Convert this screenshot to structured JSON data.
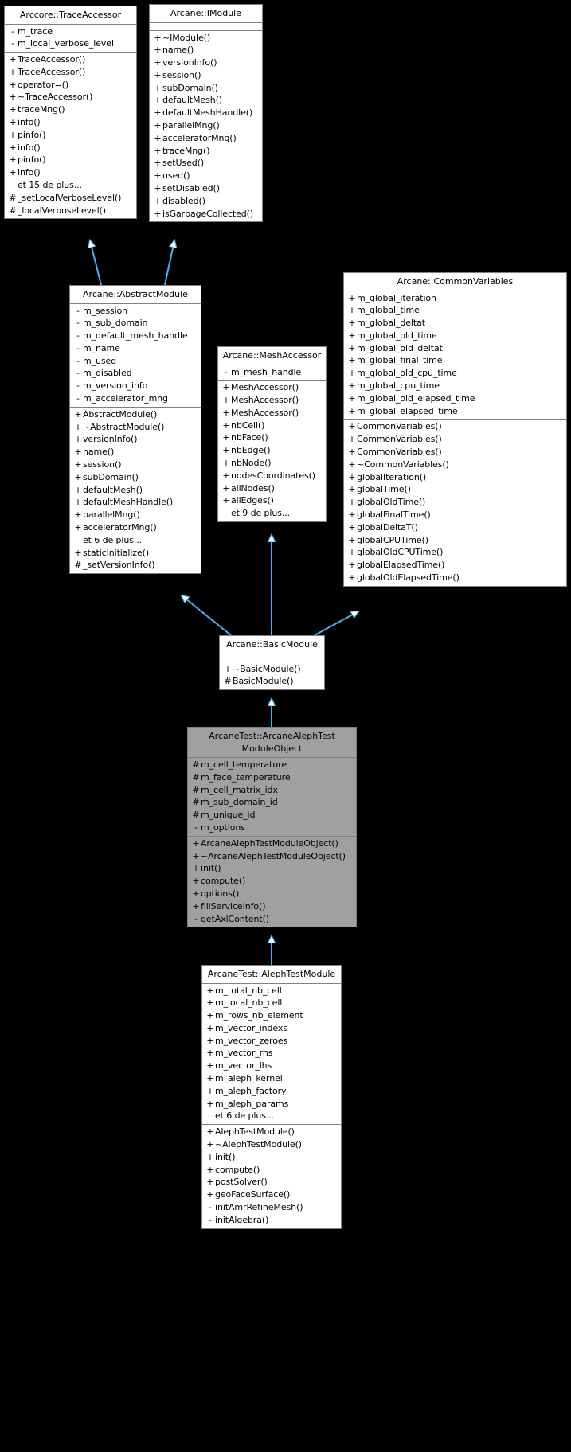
{
  "diagram": {
    "type": "uml-class-inheritance",
    "background_color": "#000000",
    "edge_color": "#4ab0f0",
    "box_fill": "#ffffff",
    "highlight_fill": "#a0a0a0",
    "border_color": "#808080"
  },
  "classes": {
    "trace_accessor": {
      "name": "Arccore::TraceAccessor",
      "attributes": [
        {
          "vis": "-",
          "label": "m_trace"
        },
        {
          "vis": "-",
          "label": "m_local_verbose_level"
        }
      ],
      "operations": [
        {
          "vis": "+",
          "label": "TraceAccessor()"
        },
        {
          "vis": "+",
          "label": "TraceAccessor()"
        },
        {
          "vis": "+",
          "label": "operator=()"
        },
        {
          "vis": "+",
          "label": "~TraceAccessor()"
        },
        {
          "vis": "+",
          "label": "traceMng()"
        },
        {
          "vis": "+",
          "label": "info()"
        },
        {
          "vis": "+",
          "label": "pinfo()"
        },
        {
          "vis": "+",
          "label": "info()"
        },
        {
          "vis": "+",
          "label": "pinfo()"
        },
        {
          "vis": "+",
          "label": "info()"
        },
        {
          "vis": "",
          "label": "et 15 de plus..."
        },
        {
          "vis": "#",
          "label": "_setLocalVerboseLevel()"
        },
        {
          "vis": "#",
          "label": "_localVerboseLevel()"
        }
      ]
    },
    "imodule": {
      "name": "Arcane::IModule",
      "attributes": [],
      "operations": [
        {
          "vis": "+",
          "label": "~IModule()"
        },
        {
          "vis": "+",
          "label": "name()"
        },
        {
          "vis": "+",
          "label": "versionInfo()"
        },
        {
          "vis": "+",
          "label": "session()"
        },
        {
          "vis": "+",
          "label": "subDomain()"
        },
        {
          "vis": "+",
          "label": "defaultMesh()"
        },
        {
          "vis": "+",
          "label": "defaultMeshHandle()"
        },
        {
          "vis": "+",
          "label": "parallelMng()"
        },
        {
          "vis": "+",
          "label": "acceleratorMng()"
        },
        {
          "vis": "+",
          "label": "traceMng()"
        },
        {
          "vis": "+",
          "label": "setUsed()"
        },
        {
          "vis": "+",
          "label": "used()"
        },
        {
          "vis": "+",
          "label": "setDisabled()"
        },
        {
          "vis": "+",
          "label": "disabled()"
        },
        {
          "vis": "+",
          "label": "isGarbageCollected()"
        }
      ]
    },
    "abstract_module": {
      "name": "Arcane::AbstractModule",
      "attributes": [
        {
          "vis": "-",
          "label": "m_session"
        },
        {
          "vis": "-",
          "label": "m_sub_domain"
        },
        {
          "vis": "-",
          "label": "m_default_mesh_handle"
        },
        {
          "vis": "-",
          "label": "m_name"
        },
        {
          "vis": "-",
          "label": "m_used"
        },
        {
          "vis": "-",
          "label": "m_disabled"
        },
        {
          "vis": "-",
          "label": "m_version_info"
        },
        {
          "vis": "-",
          "label": "m_accelerator_mng"
        }
      ],
      "operations": [
        {
          "vis": "+",
          "label": "AbstractModule()"
        },
        {
          "vis": "+",
          "label": "~AbstractModule()"
        },
        {
          "vis": "+",
          "label": "versionInfo()"
        },
        {
          "vis": "+",
          "label": "name()"
        },
        {
          "vis": "+",
          "label": "session()"
        },
        {
          "vis": "+",
          "label": "subDomain()"
        },
        {
          "vis": "+",
          "label": "defaultMesh()"
        },
        {
          "vis": "+",
          "label": "defaultMeshHandle()"
        },
        {
          "vis": "+",
          "label": "parallelMng()"
        },
        {
          "vis": "+",
          "label": "acceleratorMng()"
        },
        {
          "vis": "",
          "label": "et 6 de plus..."
        },
        {
          "vis": "+",
          "label": "staticInitialize()"
        },
        {
          "vis": "#",
          "label": "_setVersionInfo()"
        }
      ]
    },
    "mesh_accessor": {
      "name": "Arcane::MeshAccessor",
      "attributes": [
        {
          "vis": "-",
          "label": "m_mesh_handle"
        }
      ],
      "operations": [
        {
          "vis": "+",
          "label": "MeshAccessor()"
        },
        {
          "vis": "+",
          "label": "MeshAccessor()"
        },
        {
          "vis": "+",
          "label": "MeshAccessor()"
        },
        {
          "vis": "+",
          "label": "nbCell()"
        },
        {
          "vis": "+",
          "label": "nbFace()"
        },
        {
          "vis": "+",
          "label": "nbEdge()"
        },
        {
          "vis": "+",
          "label": "nbNode()"
        },
        {
          "vis": "+",
          "label": "nodesCoordinates()"
        },
        {
          "vis": "+",
          "label": "allNodes()"
        },
        {
          "vis": "+",
          "label": "allEdges()"
        },
        {
          "vis": "",
          "label": "et 9 de plus..."
        }
      ]
    },
    "common_variables": {
      "name": "Arcane::CommonVariables",
      "attributes": [
        {
          "vis": "+",
          "label": "m_global_iteration"
        },
        {
          "vis": "+",
          "label": "m_global_time"
        },
        {
          "vis": "+",
          "label": "m_global_deltat"
        },
        {
          "vis": "+",
          "label": "m_global_old_time"
        },
        {
          "vis": "+",
          "label": "m_global_old_deltat"
        },
        {
          "vis": "+",
          "label": "m_global_final_time"
        },
        {
          "vis": "+",
          "label": "m_global_old_cpu_time"
        },
        {
          "vis": "+",
          "label": "m_global_cpu_time"
        },
        {
          "vis": "+",
          "label": "m_global_old_elapsed_time"
        },
        {
          "vis": "+",
          "label": "m_global_elapsed_time"
        }
      ],
      "operations": [
        {
          "vis": "+",
          "label": "CommonVariables()"
        },
        {
          "vis": "+",
          "label": "CommonVariables()"
        },
        {
          "vis": "+",
          "label": "CommonVariables()"
        },
        {
          "vis": "+",
          "label": "~CommonVariables()"
        },
        {
          "vis": "+",
          "label": "globalIteration()"
        },
        {
          "vis": "+",
          "label": "globalTime()"
        },
        {
          "vis": "+",
          "label": "globalOldTime()"
        },
        {
          "vis": "+",
          "label": "globalFinalTime()"
        },
        {
          "vis": "+",
          "label": "globalDeltaT()"
        },
        {
          "vis": "+",
          "label": "globalCPUTime()"
        },
        {
          "vis": "+",
          "label": "globalOldCPUTime()"
        },
        {
          "vis": "+",
          "label": "globalElapsedTime()"
        },
        {
          "vis": "+",
          "label": "globalOldElapsedTime()"
        }
      ]
    },
    "basic_module": {
      "name": "Arcane::BasicModule",
      "attributes": [],
      "operations": [
        {
          "vis": "+",
          "label": "~BasicModule()"
        },
        {
          "vis": "#",
          "label": "BasicModule()"
        }
      ]
    },
    "aleph_test_module_object": {
      "name": "ArcaneTest::ArcaneAlephTest\nModuleObject",
      "highlighted": true,
      "attributes": [
        {
          "vis": "#",
          "label": "m_cell_temperature"
        },
        {
          "vis": "#",
          "label": "m_face_temperature"
        },
        {
          "vis": "#",
          "label": "m_cell_matrix_idx"
        },
        {
          "vis": "#",
          "label": "m_sub_domain_id"
        },
        {
          "vis": "#",
          "label": "m_unique_id"
        },
        {
          "vis": "-",
          "label": "m_options"
        }
      ],
      "operations": [
        {
          "vis": "+",
          "label": "ArcaneAlephTestModuleObject()"
        },
        {
          "vis": "+",
          "label": "~ArcaneAlephTestModuleObject()"
        },
        {
          "vis": "+",
          "label": "init()"
        },
        {
          "vis": "+",
          "label": "compute()"
        },
        {
          "vis": "+",
          "label": "options()"
        },
        {
          "vis": "+",
          "label": "fillServiceInfo()"
        },
        {
          "vis": "-",
          "label": "getAxlContent()"
        }
      ]
    },
    "aleph_test_module": {
      "name": "ArcaneTest::AlephTestModule",
      "attributes": [
        {
          "vis": "+",
          "label": "m_total_nb_cell"
        },
        {
          "vis": "+",
          "label": "m_local_nb_cell"
        },
        {
          "vis": "+",
          "label": "m_rows_nb_element"
        },
        {
          "vis": "+",
          "label": "m_vector_indexs"
        },
        {
          "vis": "+",
          "label": "m_vector_zeroes"
        },
        {
          "vis": "+",
          "label": "m_vector_rhs"
        },
        {
          "vis": "+",
          "label": "m_vector_lhs"
        },
        {
          "vis": "+",
          "label": "m_aleph_kernel"
        },
        {
          "vis": "+",
          "label": "m_aleph_factory"
        },
        {
          "vis": "+",
          "label": "m_aleph_params"
        },
        {
          "vis": "",
          "label": "et 6 de plus..."
        }
      ],
      "operations": [
        {
          "vis": "+",
          "label": "AlephTestModule()"
        },
        {
          "vis": "+",
          "label": "~AlephTestModule()"
        },
        {
          "vis": "+",
          "label": "init()"
        },
        {
          "vis": "+",
          "label": "compute()"
        },
        {
          "vis": "+",
          "label": "postSolver()"
        },
        {
          "vis": "+",
          "label": "geoFaceSurface()"
        },
        {
          "vis": "-",
          "label": "initAmrRefineMesh()"
        },
        {
          "vis": "-",
          "label": "initAlgebra()"
        }
      ]
    }
  }
}
